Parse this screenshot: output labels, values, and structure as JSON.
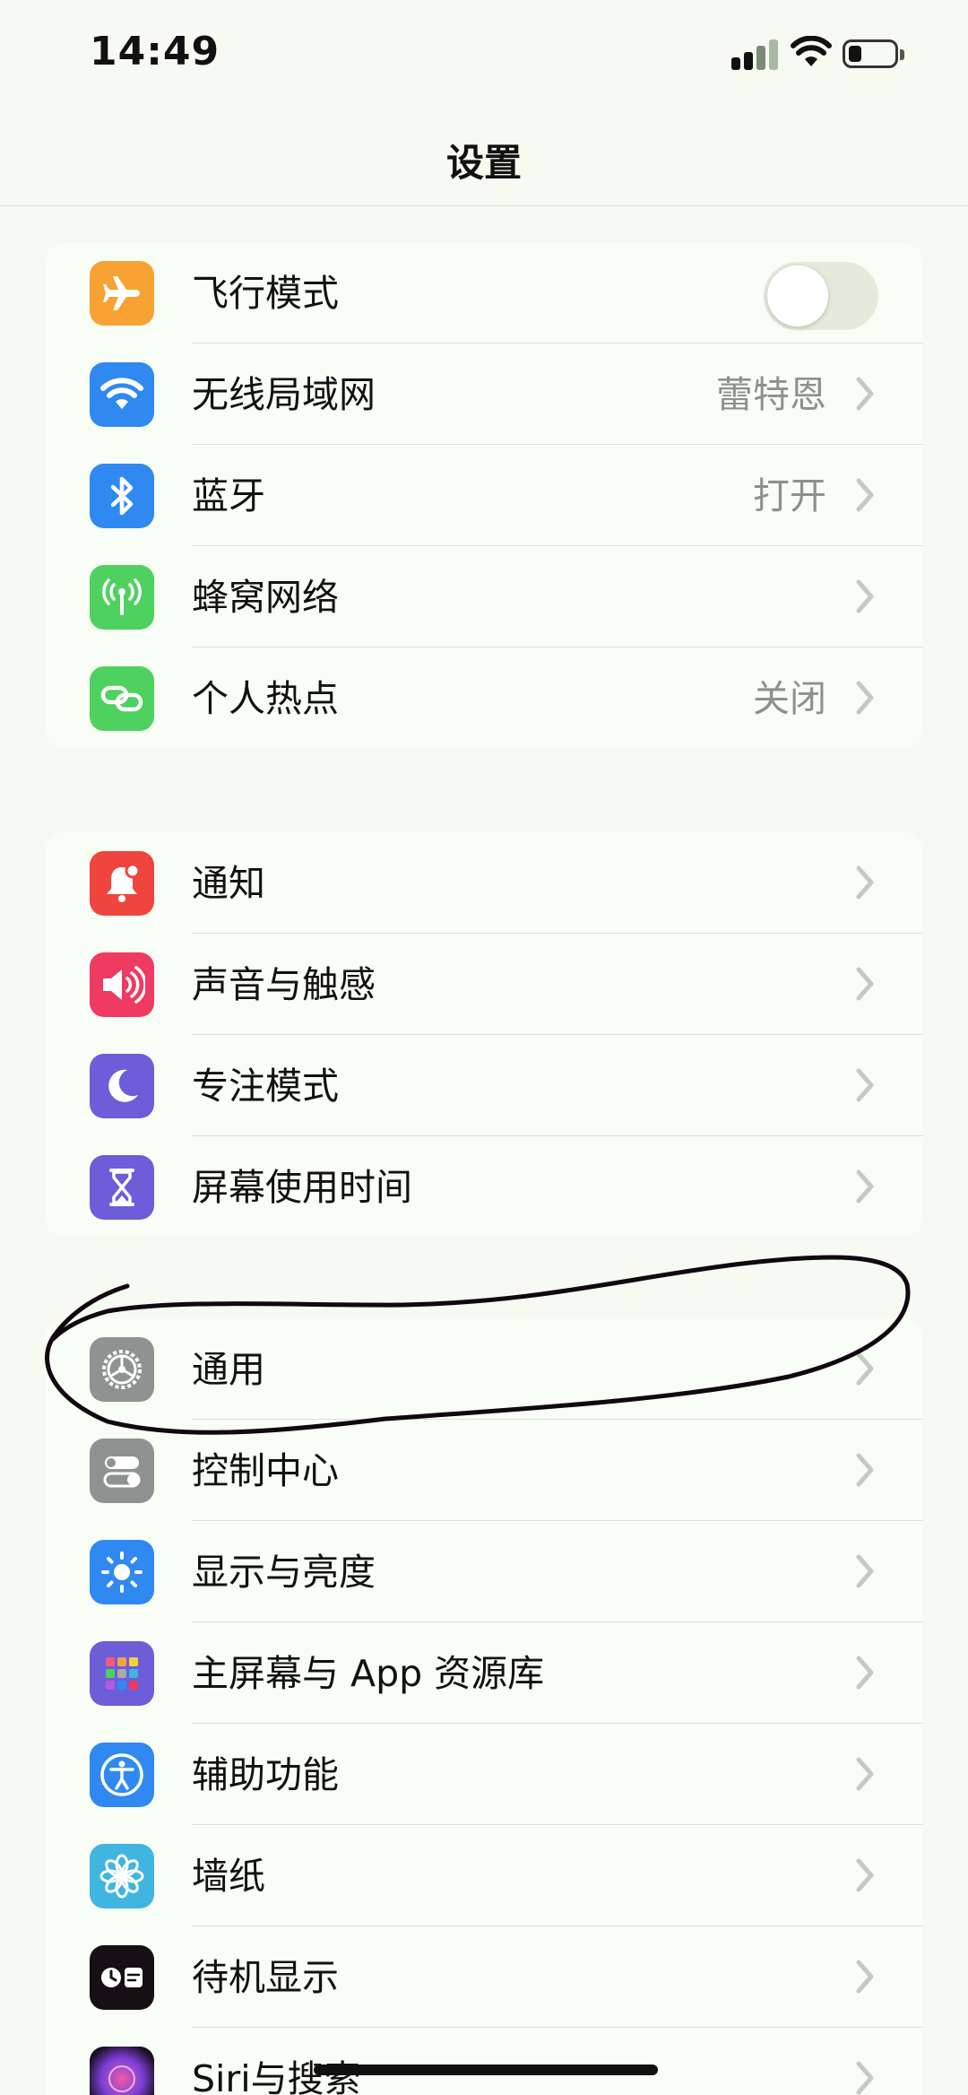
{
  "status": {
    "time": "14:49"
  },
  "nav": {
    "title": "设置"
  },
  "groups": [
    {
      "items": [
        {
          "label": "飞行模式",
          "icon": "airplane-icon",
          "color": "#f7a233",
          "toggle": false
        },
        {
          "label": "无线局域网",
          "icon": "wifi-icon",
          "color": "#2f89f0",
          "value": "蕾特恩"
        },
        {
          "label": "蓝牙",
          "icon": "bluetooth-icon",
          "color": "#2f89f0",
          "value": "打开"
        },
        {
          "label": "蜂窝网络",
          "icon": "antenna-icon",
          "color": "#4fd160"
        },
        {
          "label": "个人热点",
          "icon": "link-icon",
          "color": "#4fd160",
          "value": "关闭"
        }
      ]
    },
    {
      "items": [
        {
          "label": "通知",
          "icon": "bell-icon",
          "color": "#f0443f"
        },
        {
          "label": "声音与触感",
          "icon": "speaker-icon",
          "color": "#ef3a62"
        },
        {
          "label": "专注模式",
          "icon": "moon-icon",
          "color": "#6b5ed8"
        },
        {
          "label": "屏幕使用时间",
          "icon": "hourglass-icon",
          "color": "#6b5ed8"
        }
      ]
    },
    {
      "items": [
        {
          "label": "通用",
          "icon": "gear-icon",
          "color": "#8e9391"
        },
        {
          "label": "控制中心",
          "icon": "switches-icon",
          "color": "#8e9391"
        },
        {
          "label": "显示与亮度",
          "icon": "sun-icon",
          "color": "#2f89f0"
        },
        {
          "label": "主屏幕与 App 资源库",
          "icon": "app-grid-icon",
          "color": "#6b5ed8"
        },
        {
          "label": "辅助功能",
          "icon": "accessibility-icon",
          "color": "#2f89f0"
        },
        {
          "label": "墙纸",
          "icon": "flower-icon",
          "color": "#3fb5e0"
        },
        {
          "label": "待机显示",
          "icon": "standby-icon",
          "color": "#161015"
        },
        {
          "label": "Siri与搜索",
          "icon": "siri-icon",
          "color": "#3a2240"
        }
      ]
    }
  ]
}
